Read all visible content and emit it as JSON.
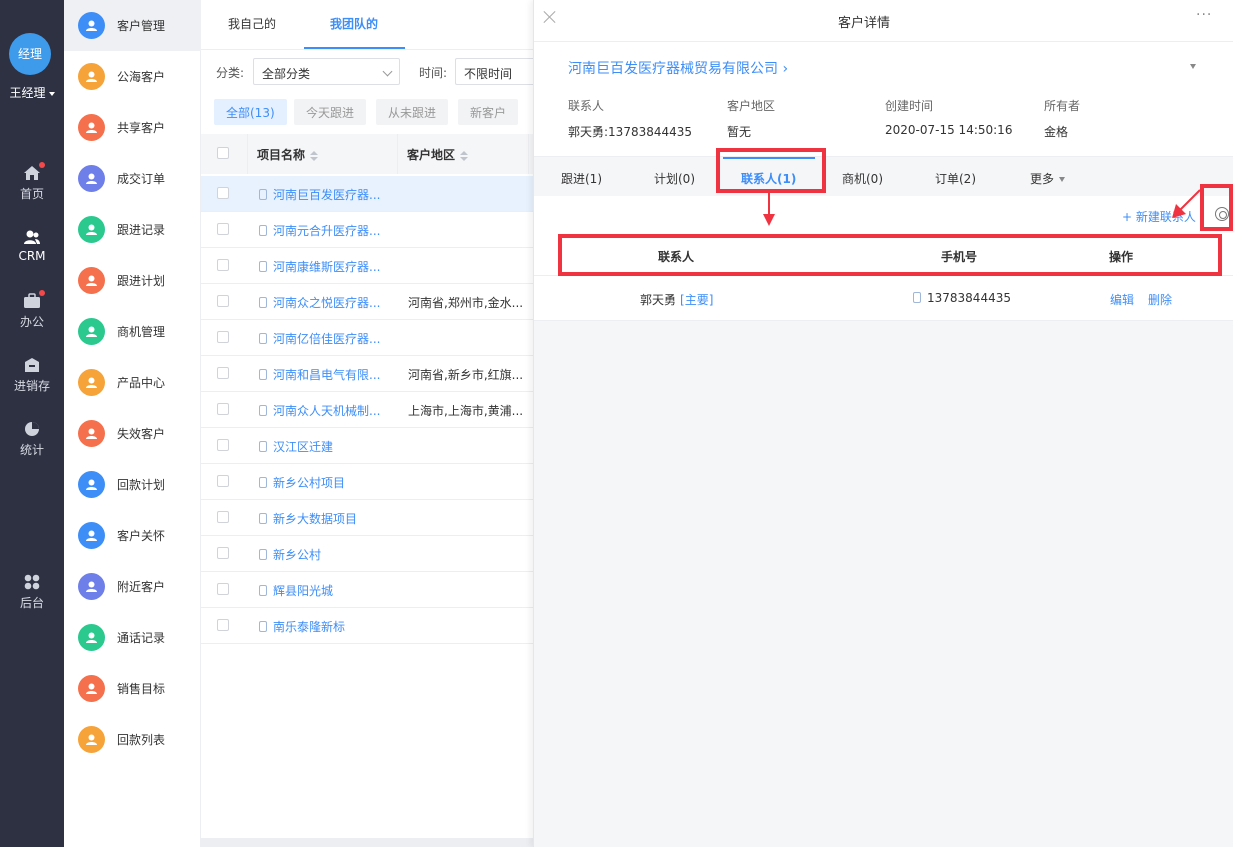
{
  "user": {
    "avatar_text": "经理",
    "name": "王经理"
  },
  "rail": [
    {
      "label": "首页",
      "icon": "home-icon",
      "dot": true
    },
    {
      "label": "CRM",
      "icon": "crm-users-icon",
      "active": true
    },
    {
      "label": "办公",
      "icon": "briefcase-icon",
      "dot": true
    },
    {
      "label": "进销存",
      "icon": "warehouse-icon"
    },
    {
      "label": "统计",
      "icon": "pie-chart-icon"
    },
    {
      "label": "后台",
      "icon": "grid-icon"
    }
  ],
  "submenu": [
    {
      "label": "客户管理",
      "color": "#3e8ef7",
      "active": true
    },
    {
      "label": "公海客户",
      "color": "#f6a33a"
    },
    {
      "label": "共享客户",
      "color": "#f5704c"
    },
    {
      "label": "成交订单",
      "color": "#6f7fea"
    },
    {
      "label": "跟进记录",
      "color": "#2cc98f"
    },
    {
      "label": "跟进计划",
      "color": "#f5704c"
    },
    {
      "label": "商机管理",
      "color": "#2cc98f"
    },
    {
      "label": "产品中心",
      "color": "#f6a33a"
    },
    {
      "label": "失效客户",
      "color": "#f5704c"
    },
    {
      "label": "回款计划",
      "color": "#3e8ef7"
    },
    {
      "label": "客户关怀",
      "color": "#3e8ef7"
    },
    {
      "label": "附近客户",
      "color": "#6f7fea"
    },
    {
      "label": "通话记录",
      "color": "#2cc98f"
    },
    {
      "label": "销售目标",
      "color": "#f5704c"
    },
    {
      "label": "回款列表",
      "color": "#f6a33a"
    }
  ],
  "list": {
    "tabs": [
      "我自己的",
      "我团队的"
    ],
    "active_tab": 1,
    "filter_category_label": "分类:",
    "filter_category_value": "全部分类",
    "filter_time_label": "时间:",
    "filter_time_value": "不限时间",
    "quick_filters": [
      "全部(13)",
      "今天跟进",
      "从未跟进",
      "新客户"
    ],
    "columns": [
      "项目名称",
      "客户地区"
    ],
    "rows": [
      {
        "name": "河南巨百发医疗器...",
        "area": "",
        "highlight": true
      },
      {
        "name": "河南元合升医疗器...",
        "area": ""
      },
      {
        "name": "河南康维斯医疗器...",
        "area": ""
      },
      {
        "name": "河南众之悦医疗器...",
        "area": "河南省,郑州市,金水..."
      },
      {
        "name": "河南亿倍佳医疗器...",
        "area": ""
      },
      {
        "name": "河南和昌电气有限...",
        "area": "河南省,新乡市,红旗..."
      },
      {
        "name": "河南众人天机械制...",
        "area": "上海市,上海市,黄浦..."
      },
      {
        "name": "汉江区迁建",
        "area": ""
      },
      {
        "name": "新乡公村项目",
        "area": ""
      },
      {
        "name": "新乡大数据项目",
        "area": ""
      },
      {
        "name": "新乡公村",
        "area": ""
      },
      {
        "name": "辉县阳光城",
        "area": ""
      },
      {
        "name": "南乐泰隆新标",
        "area": ""
      }
    ]
  },
  "detail": {
    "title": "客户详情",
    "more": "···",
    "company": "河南巨百发医疗器械贸易有限公司 ›",
    "info": [
      {
        "label": "联系人",
        "value": "郭天勇:13783844435"
      },
      {
        "label": "客户地区",
        "value": "暂无"
      },
      {
        "label": "创建时间",
        "value": "2020-07-15 14:50:16"
      },
      {
        "label": "所有者",
        "value": "金格"
      }
    ],
    "tabs": [
      "跟进(1)",
      "计划(0)",
      "联系人(1)",
      "商机(0)",
      "订单(2)",
      "更多"
    ],
    "active_tab": 2,
    "new_contact": "+ 新建联系人",
    "contact_columns": [
      "联系人",
      "手机号",
      "操作"
    ],
    "contacts": [
      {
        "name": "郭天勇",
        "tag": "[主要]",
        "phone": "13783844435",
        "edit": "编辑",
        "delete": "删除"
      }
    ]
  },
  "annotation_color": "#ef3340"
}
